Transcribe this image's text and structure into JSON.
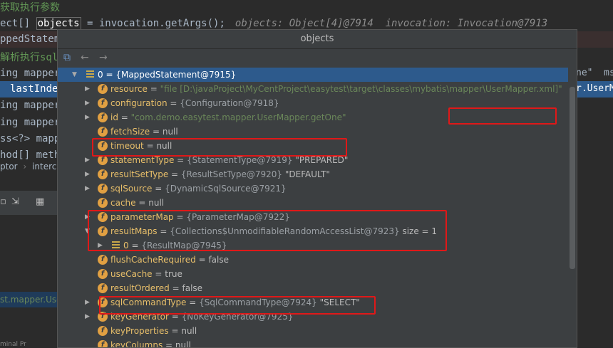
{
  "editor": {
    "lines": [
      {
        "text": "获取执行参数"
      },
      {
        "text_a": "ect[] ",
        "var": "objects",
        "text_b": " = invocation.getArgs();",
        "hint": "objects: Object[4]@7914  invocation: Invocation@7913"
      },
      {
        "text": "ppedStateme"
      },
      {
        "text": "解析执行sql"
      },
      {
        "text": "ing mapper"
      },
      {
        "text": "lastIndex"
      },
      {
        "text": "ing mapper"
      },
      {
        "text": "ing mapper"
      },
      {
        "text": "ss<?> mapp"
      },
      {
        "text": "hod[] meth"
      }
    ],
    "breadcrumb": [
      "ptor",
      "interc"
    ],
    "right_strip": [
      "ne\"  ms",
      "r.UserM"
    ],
    "debug_line": "st.mapper.Use",
    "bottom_text": "minal   Pr"
  },
  "popup": {
    "title": "objects",
    "nodes": [
      {
        "name": "0",
        "value": "{MappedStatement@7915}",
        "icon": "array",
        "expanded": true,
        "selected": true
      },
      {
        "name": "resource",
        "value": "\"file [D:\\javaProject\\MyCentProject\\easytest\\target\\classes\\mybatis\\mapper\\UserMapper.xml]\"",
        "kind": "str",
        "has_children": true
      },
      {
        "name": "configuration",
        "value": "{Configuration@7918}",
        "kind": "ref",
        "has_children": true
      },
      {
        "name": "id",
        "value": "\"com.demo.easytest.mapper.UserMapper.getOne\"",
        "kind": "str",
        "has_children": true
      },
      {
        "name": "fetchSize",
        "value": "null"
      },
      {
        "name": "timeout",
        "value": "null"
      },
      {
        "name": "statementType",
        "value": "{StatementType@7919}",
        "extra": "\"PREPARED\"",
        "kind": "ref",
        "has_children": true
      },
      {
        "name": "resultSetType",
        "value": "{ResultSetType@7920}",
        "extra": "\"DEFAULT\"",
        "kind": "ref",
        "has_children": true
      },
      {
        "name": "sqlSource",
        "value": "{DynamicSqlSource@7921}",
        "kind": "ref",
        "has_children": true
      },
      {
        "name": "cache",
        "value": "null"
      },
      {
        "name": "parameterMap",
        "value": "{ParameterMap@7922}",
        "kind": "ref",
        "has_children": true
      },
      {
        "name": "resultMaps",
        "value": "{Collections$UnmodifiableRandomAccessList@7923}",
        "extra": "size = 1",
        "kind": "ref",
        "has_children": true,
        "expanded": true
      },
      {
        "name": "0",
        "value": "{ResultMap@7945}",
        "icon": "array",
        "kind": "ref",
        "has_children": true,
        "child": true
      },
      {
        "name": "flushCacheRequired",
        "value": "false"
      },
      {
        "name": "useCache",
        "value": "true"
      },
      {
        "name": "resultOrdered",
        "value": "false"
      },
      {
        "name": "sqlCommandType",
        "value": "{SqlCommandType@7924}",
        "extra": "\"SELECT\"",
        "kind": "ref",
        "has_children": true
      },
      {
        "name": "keyGenerator",
        "value": "{NoKeyGenerator@7925}",
        "kind": "ref",
        "has_children": true
      },
      {
        "name": "keyProperties",
        "value": "null"
      },
      {
        "name": "keyColumns",
        "value": "null"
      }
    ]
  },
  "colors": {
    "highlight_box": "#e01818",
    "selection": "#2d5a8c",
    "field_icon": "#e1a042"
  }
}
